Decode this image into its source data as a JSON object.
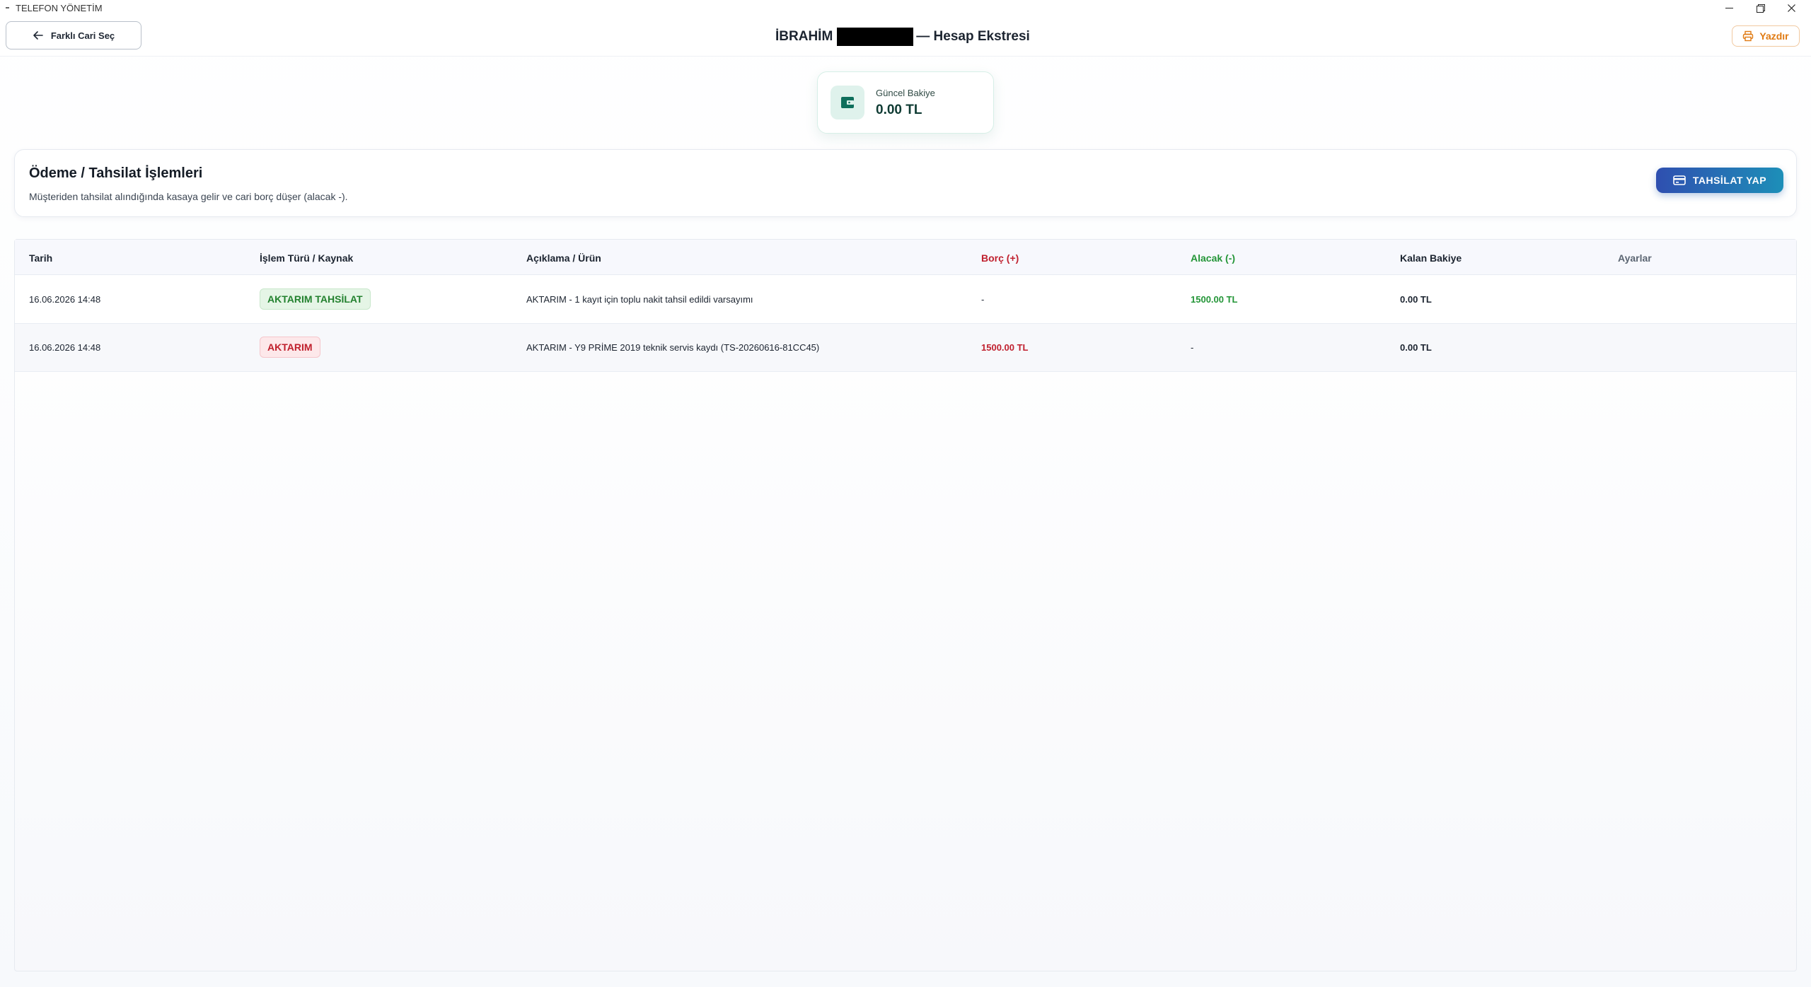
{
  "window": {
    "title": "TELEFON YÖNETİM"
  },
  "header": {
    "back_label": "Farklı Cari Seç",
    "title_name": "İBRAHİM",
    "title_suffix": "— Hesap Ekstresi",
    "print_label": "Yazdır"
  },
  "balance": {
    "label": "Güncel Bakiye",
    "value": "0.00 TL"
  },
  "operations": {
    "title": "Ödeme / Tahsilat İşlemleri",
    "description": "Müşteriden tahsilat alındığında kasaya gelir ve cari borç düşer (alacak -).",
    "button_label": "TAHSİLAT YAP"
  },
  "table": {
    "columns": [
      "Tarih",
      "İşlem Türü / Kaynak",
      "Açıklama / Ürün",
      "Borç (+)",
      "Alacak (-)",
      "Kalan Bakiye",
      "Ayarlar"
    ],
    "rows": [
      {
        "date": "16.06.2026 14:48",
        "type": "AKTARIM TAHSİLAT",
        "description": "AKTARIM - 1 kayıt için toplu nakit tahsil edildi varsayımı",
        "borc": "-",
        "alacak": "1500.00 TL",
        "kalan": "0.00 TL"
      },
      {
        "date": "16.06.2026 14:48",
        "type": "AKTARIM",
        "description": "AKTARIM - Y9 PRİME 2019 teknik servis kaydı (TS-20260616-81CC45)",
        "borc": "1500.00 TL",
        "alacak": "-",
        "kalan": "0.00 TL"
      }
    ]
  },
  "colors": {
    "accent_green": "#239537",
    "accent_red": "#c0212f",
    "print_orange": "#e07a12",
    "button_gradient_start": "#2f4fb0",
    "button_gradient_end": "#1d8fb8"
  }
}
